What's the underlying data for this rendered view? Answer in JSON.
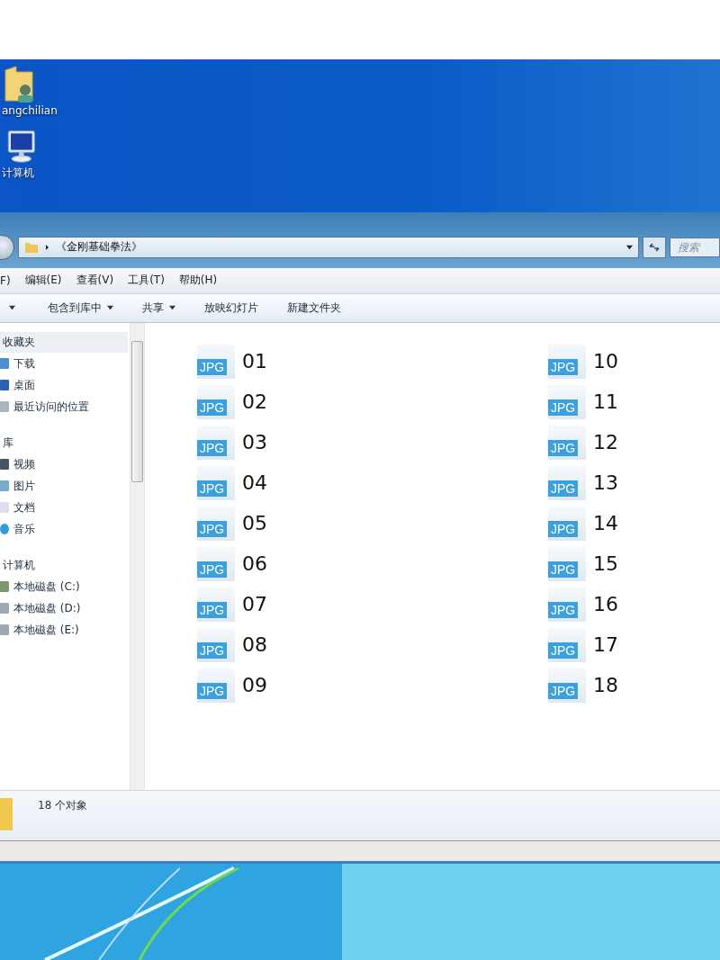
{
  "desktop_icons": [
    {
      "label": "angchilian",
      "kind": "user-folder"
    },
    {
      "label": "计算机",
      "kind": "computer"
    }
  ],
  "address_bar": {
    "path": "《金刚基础拳法》"
  },
  "search": {
    "placeholder": "搜索"
  },
  "menu_bar": [
    "F)",
    "编辑(E)",
    "查看(V)",
    "工具(T)",
    "帮助(H)"
  ],
  "toolbar": [
    {
      "label": "包含到库中",
      "dropdown": true
    },
    {
      "label": "共享",
      "dropdown": true
    },
    {
      "label": "放映幻灯片",
      "dropdown": false
    },
    {
      "label": "新建文件夹",
      "dropdown": false
    }
  ],
  "sidebar": {
    "items": [
      {
        "label": "收藏夹",
        "selected": true,
        "children": [
          {
            "label": "下载",
            "kind": "download"
          },
          {
            "label": "桌面",
            "kind": "desktop"
          },
          {
            "label": "最近访问的位置",
            "kind": "recent"
          }
        ]
      },
      {
        "label": "库",
        "selected": false,
        "children": [
          {
            "label": "视频",
            "kind": "video"
          },
          {
            "label": "图片",
            "kind": "picture"
          },
          {
            "label": "文档",
            "kind": "document"
          },
          {
            "label": "音乐",
            "kind": "music"
          }
        ]
      },
      {
        "label": "计算机",
        "selected": false,
        "children": [
          {
            "label": "本地磁盘 (C:)",
            "kind": "system-drive"
          },
          {
            "label": "本地磁盘 (D:)",
            "kind": "drive"
          },
          {
            "label": "本地磁盘 (E:)",
            "kind": "drive"
          }
        ]
      }
    ]
  },
  "files": [
    {
      "name": "01",
      "type": "JPG"
    },
    {
      "name": "02",
      "type": "JPG"
    },
    {
      "name": "03",
      "type": "JPG"
    },
    {
      "name": "04",
      "type": "JPG"
    },
    {
      "name": "05",
      "type": "JPG"
    },
    {
      "name": "06",
      "type": "JPG"
    },
    {
      "name": "07",
      "type": "JPG"
    },
    {
      "name": "08",
      "type": "JPG"
    },
    {
      "name": "09",
      "type": "JPG"
    },
    {
      "name": "10",
      "type": "JPG"
    },
    {
      "name": "11",
      "type": "JPG"
    },
    {
      "name": "12",
      "type": "JPG"
    },
    {
      "name": "13",
      "type": "JPG"
    },
    {
      "name": "14",
      "type": "JPG"
    },
    {
      "name": "15",
      "type": "JPG"
    },
    {
      "name": "16",
      "type": "JPG"
    },
    {
      "name": "17",
      "type": "JPG"
    },
    {
      "name": "18",
      "type": "JPG"
    }
  ],
  "status_bar": {
    "text": "18 个对象"
  }
}
